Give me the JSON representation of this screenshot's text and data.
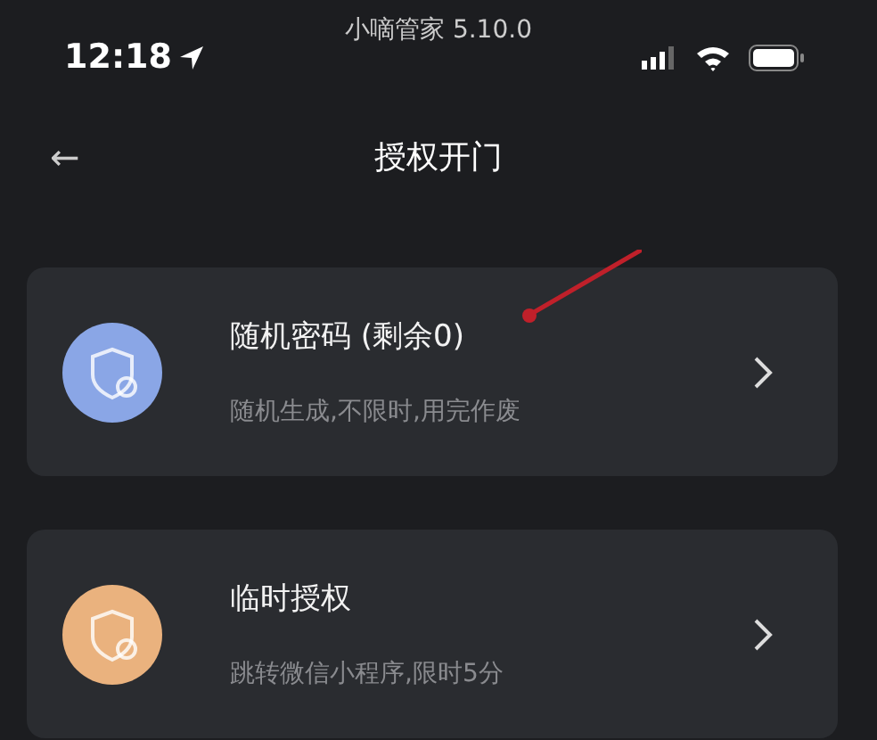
{
  "status_bar": {
    "app_label": "小嘀管家 5.10.0",
    "time": "12:18"
  },
  "nav": {
    "back": "←",
    "title": "授权开门"
  },
  "options": [
    {
      "title": "随机密码 (剩余0)",
      "subtitle": "随机生成,不限时,用完作废",
      "kind": "password"
    },
    {
      "title": "临时授权",
      "subtitle": "跳转微信小程序,限时5分",
      "kind": "temporary"
    }
  ]
}
